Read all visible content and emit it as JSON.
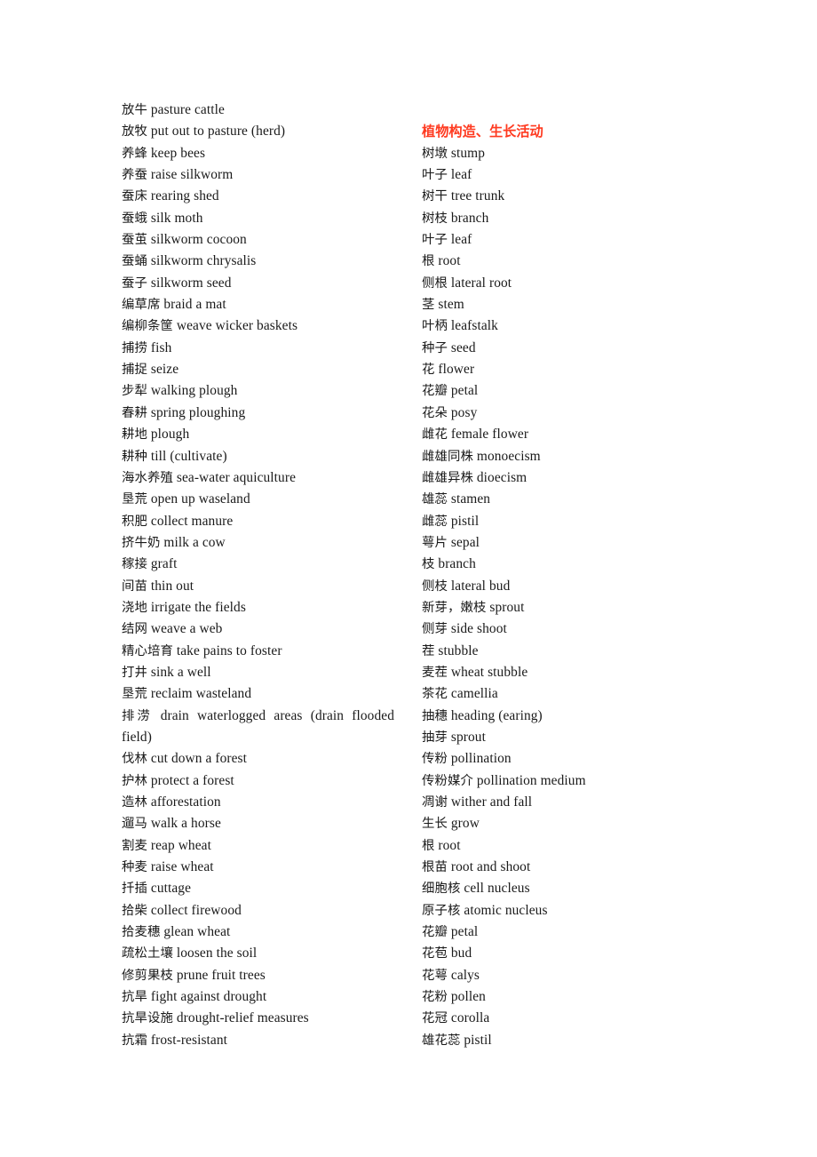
{
  "document": {
    "type": "bilingual-glossary",
    "background_color": "#ffffff",
    "text_color": "#1a1a1a",
    "accent_color": "#ff3a20",
    "columns": 2
  },
  "left_column": {
    "entries": [
      {
        "zh": "放牛",
        "en": "pasture cattle"
      },
      {
        "zh": "放牧",
        "en": "put out to pasture (herd)"
      },
      {
        "zh": "养蜂",
        "en": "keep bees"
      },
      {
        "zh": "养蚕",
        "en": "raise silkworm"
      },
      {
        "zh": "蚕床",
        "en": "rearing shed"
      },
      {
        "zh": "蚕蛾",
        "en": "silk moth"
      },
      {
        "zh": "蚕茧",
        "en": "silkworm cocoon"
      },
      {
        "zh": "蚕蛹",
        "en": "silkworm chrysalis"
      },
      {
        "zh": "蚕子",
        "en": "silkworm seed"
      },
      {
        "zh": "编草席",
        "en": "braid a mat"
      },
      {
        "zh": "编柳条筐",
        "en": "weave wicker baskets"
      },
      {
        "zh": "捕捞",
        "en": "fish"
      },
      {
        "zh": "捕捉",
        "en": "seize"
      },
      {
        "zh": "步犁",
        "en": "walking plough"
      },
      {
        "zh": "春耕",
        "en": "spring ploughing"
      },
      {
        "zh": "耕地",
        "en": "plough"
      },
      {
        "zh": "耕种",
        "en": "till (cultivate)"
      },
      {
        "zh": "海水养殖",
        "en": "sea-water aquiculture"
      },
      {
        "zh": "垦荒",
        "en": "open up waseland"
      },
      {
        "zh": "积肥",
        "en": "collect manure"
      },
      {
        "zh": "挤牛奶",
        "en": "milk a cow"
      },
      {
        "zh": "稼接",
        "en": "graft"
      },
      {
        "zh": "间苗",
        "en": "thin out"
      },
      {
        "zh": "浇地",
        "en": "irrigate the fields"
      },
      {
        "zh": "结网",
        "en": "weave a web"
      },
      {
        "zh": "精心培育",
        "en": "take pains to foster"
      },
      {
        "zh": "打井",
        "en": "sink a well"
      },
      {
        "zh": "垦荒",
        "en": "reclaim wasteland"
      },
      {
        "zh": "排涝",
        "en": "drain waterlogged areas (drain flooded field)",
        "wrap": true
      },
      {
        "zh": "伐林",
        "en": "cut down a forest"
      },
      {
        "zh": "护林",
        "en": "protect a forest"
      },
      {
        "zh": "造林",
        "en": "afforestation"
      },
      {
        "zh": "遛马",
        "en": "walk a horse"
      },
      {
        "zh": "割麦",
        "en": "reap wheat"
      },
      {
        "zh": "种麦",
        "en": "raise wheat"
      },
      {
        "zh": "扦插",
        "en": "cuttage"
      },
      {
        "zh": "拾柴",
        "en": "collect firewood"
      },
      {
        "zh": "拾麦穗",
        "en": "glean wheat"
      },
      {
        "zh": "疏松土壤",
        "en": "loosen the soil"
      },
      {
        "zh": "修剪果枝",
        "en": "prune fruit trees"
      },
      {
        "zh": "抗旱",
        "en": "fight against drought"
      },
      {
        "zh": "抗旱设施",
        "en": "drought-relief measures"
      },
      {
        "zh": "抗霜",
        "en": "frost-resistant"
      }
    ]
  },
  "right_column": {
    "section_heading": "植物构造、生长活动",
    "entries": [
      {
        "zh": "树墩",
        "en": "stump"
      },
      {
        "zh": "叶子",
        "en": "leaf"
      },
      {
        "zh": "树干",
        "en": " tree trunk"
      },
      {
        "zh": "树枝",
        "en": " branch"
      },
      {
        "zh": "叶子",
        "en": " leaf"
      },
      {
        "zh": "根",
        "en": " root"
      },
      {
        "zh": "侧根",
        "en": "lateral root"
      },
      {
        "zh": "茎",
        "en": " stem"
      },
      {
        "zh": "叶柄",
        "en": " leafstalk"
      },
      {
        "zh": "种子",
        "en": " seed"
      },
      {
        "zh": "花",
        "en": "flower"
      },
      {
        "zh": "花瓣",
        "en": " petal"
      },
      {
        "zh": "花朵",
        "en": " posy"
      },
      {
        "zh": "雌花",
        "en": "female flower"
      },
      {
        "zh": "雌雄同株",
        "en": "monoecism"
      },
      {
        "zh": "雌雄异株",
        "en": "dioecism"
      },
      {
        "zh": "雄蕊",
        "en": " stamen"
      },
      {
        "zh": "雌蕊",
        "en": " pistil"
      },
      {
        "zh": "萼片",
        "en": "sepal"
      },
      {
        "zh": "枝",
        "en": "branch"
      },
      {
        "zh": "侧枝",
        "en": "lateral bud"
      },
      {
        "zh": "新芽，嫩枝",
        "en": "sprout"
      },
      {
        "zh": "侧芽",
        "en": "side shoot"
      },
      {
        "zh": "茬",
        "en": "stubble"
      },
      {
        "zh": "麦茬",
        "en": "wheat stubble"
      },
      {
        "zh": "茶花",
        "en": "camellia"
      },
      {
        "zh": "抽穗",
        "en": "heading (earing)"
      },
      {
        "zh": "抽芽",
        "en": "sprout"
      },
      {
        "zh": "传粉",
        "en": "pollination"
      },
      {
        "zh": "传粉媒介",
        "en": "pollination medium"
      },
      {
        "zh": "凋谢",
        "en": "wither and fall"
      },
      {
        "zh": "生长",
        "en": "grow"
      },
      {
        "zh": "根",
        "en": "root"
      },
      {
        "zh": "根苗",
        "en": "root and shoot"
      },
      {
        "zh": "细胞核",
        "en": "cell nucleus"
      },
      {
        "zh": "原子核",
        "en": "atomic nucleus"
      },
      {
        "zh": "花瓣",
        "en": "petal"
      },
      {
        "zh": "花苞",
        "en": "bud"
      },
      {
        "zh": "花萼",
        "en": "calys"
      },
      {
        "zh": "花粉",
        "en": "pollen"
      },
      {
        "zh": "花冠",
        "en": "corolla"
      },
      {
        "zh": "雄花蕊",
        "en": "pistil"
      }
    ]
  }
}
